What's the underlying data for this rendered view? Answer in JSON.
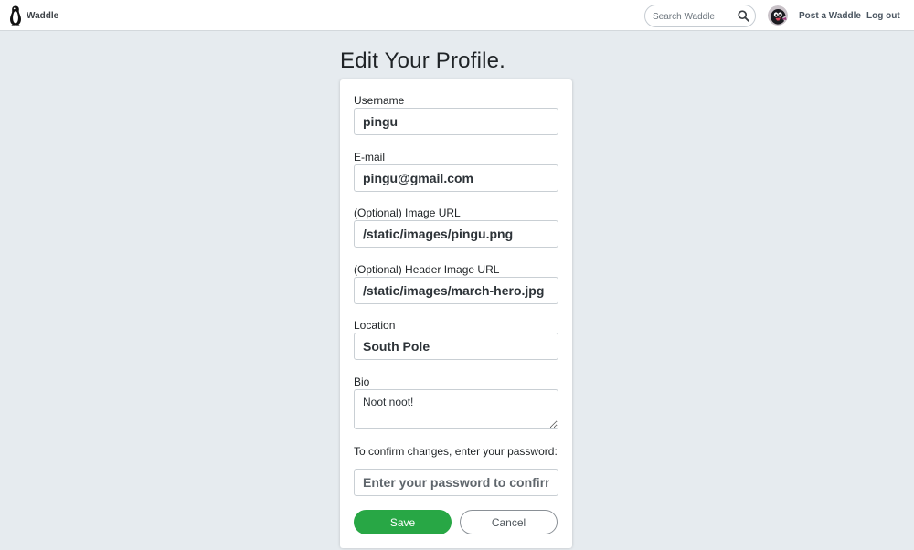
{
  "navbar": {
    "brand_label": "Waddle",
    "search_placeholder": "Search Waddle",
    "post_label": "Post a Waddle",
    "logout_label": "Log out"
  },
  "page": {
    "title": "Edit Your Profile."
  },
  "form": {
    "username": {
      "label": "Username",
      "value": "pingu"
    },
    "email": {
      "label": "E-mail",
      "value": "pingu@gmail.com"
    },
    "image_url": {
      "label": "(Optional) Image URL",
      "value": "/static/images/pingu.png"
    },
    "header_image_url": {
      "label": "(Optional) Header Image URL",
      "value": "/static/images/march-hero.jpg"
    },
    "location": {
      "label": "Location",
      "value": "South Pole"
    },
    "bio": {
      "label": "Bio",
      "value": "Noot noot!"
    },
    "password": {
      "label": "To confirm changes, enter your password:",
      "placeholder": "Enter your password to confirm"
    },
    "save_label": "Save",
    "cancel_label": "Cancel"
  },
  "colors": {
    "save_button": "#28a745",
    "page_background": "#e6ebef"
  }
}
